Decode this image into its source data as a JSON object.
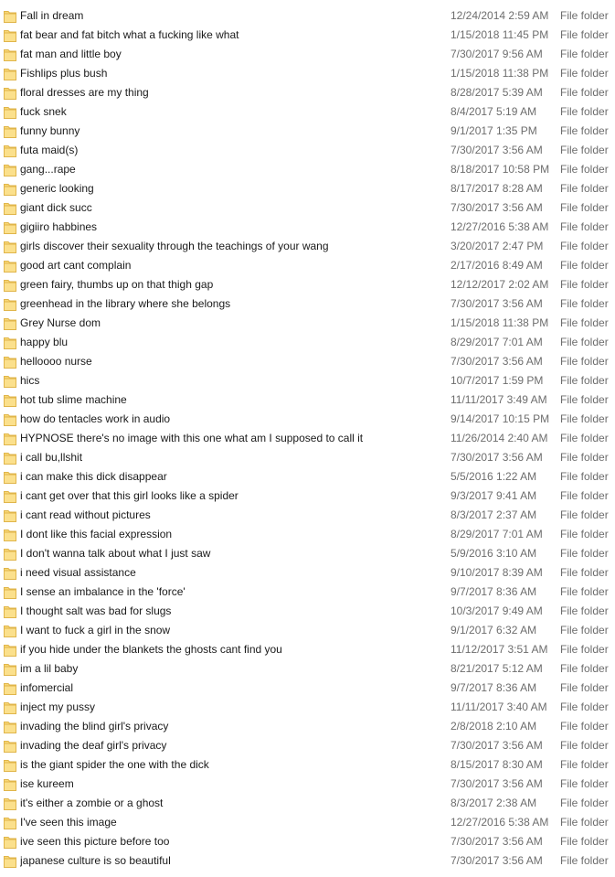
{
  "icons": {
    "folder": "folder-icon"
  },
  "colors": {
    "folder_fill": "#f8d775",
    "folder_edge": "#e0b54a",
    "meta_text": "#6d6d6d"
  },
  "files": [
    {
      "name": "Fall in dream",
      "date": "12/24/2014 2:59 AM",
      "type": "File folder"
    },
    {
      "name": "fat bear and fat bitch what a fucking like what",
      "date": "1/15/2018 11:45 PM",
      "type": "File folder"
    },
    {
      "name": "fat man and little boy",
      "date": "7/30/2017 9:56 AM",
      "type": "File folder"
    },
    {
      "name": "Fishlips plus bush",
      "date": "1/15/2018 11:38 PM",
      "type": "File folder"
    },
    {
      "name": "floral dresses are my thing",
      "date": "8/28/2017 5:39 AM",
      "type": "File folder"
    },
    {
      "name": "fuck snek",
      "date": "8/4/2017 5:19 AM",
      "type": "File folder"
    },
    {
      "name": "funny bunny",
      "date": "9/1/2017 1:35 PM",
      "type": "File folder"
    },
    {
      "name": "futa maid(s)",
      "date": "7/30/2017 3:56 AM",
      "type": "File folder"
    },
    {
      "name": "gang...rape",
      "date": "8/18/2017 10:58 PM",
      "type": "File folder"
    },
    {
      "name": "generic looking",
      "date": "8/17/2017 8:28 AM",
      "type": "File folder"
    },
    {
      "name": "giant dick succ",
      "date": "7/30/2017 3:56 AM",
      "type": "File folder"
    },
    {
      "name": "gigiiro habbines",
      "date": "12/27/2016 5:38 AM",
      "type": "File folder"
    },
    {
      "name": "girls discover their sexuality through the teachings of your wang",
      "date": "3/20/2017 2:47 PM",
      "type": "File folder"
    },
    {
      "name": "good art cant complain",
      "date": "2/17/2016 8:49 AM",
      "type": "File folder"
    },
    {
      "name": "green fairy, thumbs up on that thigh gap",
      "date": "12/12/2017 2:02 AM",
      "type": "File folder"
    },
    {
      "name": "greenhead in the library where she belongs",
      "date": "7/30/2017 3:56 AM",
      "type": "File folder"
    },
    {
      "name": "Grey Nurse dom",
      "date": "1/15/2018 11:38 PM",
      "type": "File folder"
    },
    {
      "name": "happy blu",
      "date": "8/29/2017 7:01 AM",
      "type": "File folder"
    },
    {
      "name": "helloooo nurse",
      "date": "7/30/2017 3:56 AM",
      "type": "File folder"
    },
    {
      "name": "hics",
      "date": "10/7/2017 1:59 PM",
      "type": "File folder"
    },
    {
      "name": "hot tub slime machine",
      "date": "11/11/2017 3:49 AM",
      "type": "File folder"
    },
    {
      "name": "how do tentacles work in audio",
      "date": "9/14/2017 10:15 PM",
      "type": "File folder"
    },
    {
      "name": "HYPNOSE there's no image with this one what am I supposed to call it",
      "date": "11/26/2014 2:40 AM",
      "type": "File folder"
    },
    {
      "name": "i call bu,llshit",
      "date": "7/30/2017 3:56 AM",
      "type": "File folder"
    },
    {
      "name": "i can make this dick disappear",
      "date": "5/5/2016 1:22 AM",
      "type": "File folder"
    },
    {
      "name": "i cant get over that this girl looks like a spider",
      "date": "9/3/2017 9:41 AM",
      "type": "File folder"
    },
    {
      "name": "i cant read without pictures",
      "date": "8/3/2017 2:37 AM",
      "type": "File folder"
    },
    {
      "name": "I dont like this facial expression",
      "date": "8/29/2017 7:01 AM",
      "type": "File folder"
    },
    {
      "name": "I don't wanna talk about what I just saw",
      "date": "5/9/2016 3:10 AM",
      "type": "File folder"
    },
    {
      "name": "i need visual assistance",
      "date": "9/10/2017 8:39 AM",
      "type": "File folder"
    },
    {
      "name": "I sense an imbalance in the 'force'",
      "date": "9/7/2017 8:36 AM",
      "type": "File folder"
    },
    {
      "name": "I thought salt was bad for slugs",
      "date": "10/3/2017 9:49 AM",
      "type": "File folder"
    },
    {
      "name": "I want to fuck a girl in the snow",
      "date": "9/1/2017 6:32 AM",
      "type": "File folder"
    },
    {
      "name": "if you hide under the blankets the ghosts cant find you",
      "date": "11/12/2017 3:51 AM",
      "type": "File folder"
    },
    {
      "name": "im a lil baby",
      "date": "8/21/2017 5:12 AM",
      "type": "File folder"
    },
    {
      "name": "infomercial",
      "date": "9/7/2017 8:36 AM",
      "type": "File folder"
    },
    {
      "name": "inject my pussy",
      "date": "11/11/2017 3:40 AM",
      "type": "File folder"
    },
    {
      "name": "invading the blind girl's privacy",
      "date": "2/8/2018 2:10 AM",
      "type": "File folder"
    },
    {
      "name": "invading the deaf girl's privacy",
      "date": "7/30/2017 3:56 AM",
      "type": "File folder"
    },
    {
      "name": "is the giant spider the one with the dick",
      "date": "8/15/2017 8:30 AM",
      "type": "File folder"
    },
    {
      "name": "ise kureem",
      "date": "7/30/2017 3:56 AM",
      "type": "File folder"
    },
    {
      "name": "it's either a zombie or a ghost",
      "date": "8/3/2017 2:38 AM",
      "type": "File folder"
    },
    {
      "name": "I've seen this image",
      "date": "12/27/2016 5:38 AM",
      "type": "File folder"
    },
    {
      "name": "ive seen this picture before too",
      "date": "7/30/2017 3:56 AM",
      "type": "File folder"
    },
    {
      "name": "japanese culture is so beautiful",
      "date": "7/30/2017 3:56 AM",
      "type": "File folder"
    }
  ]
}
